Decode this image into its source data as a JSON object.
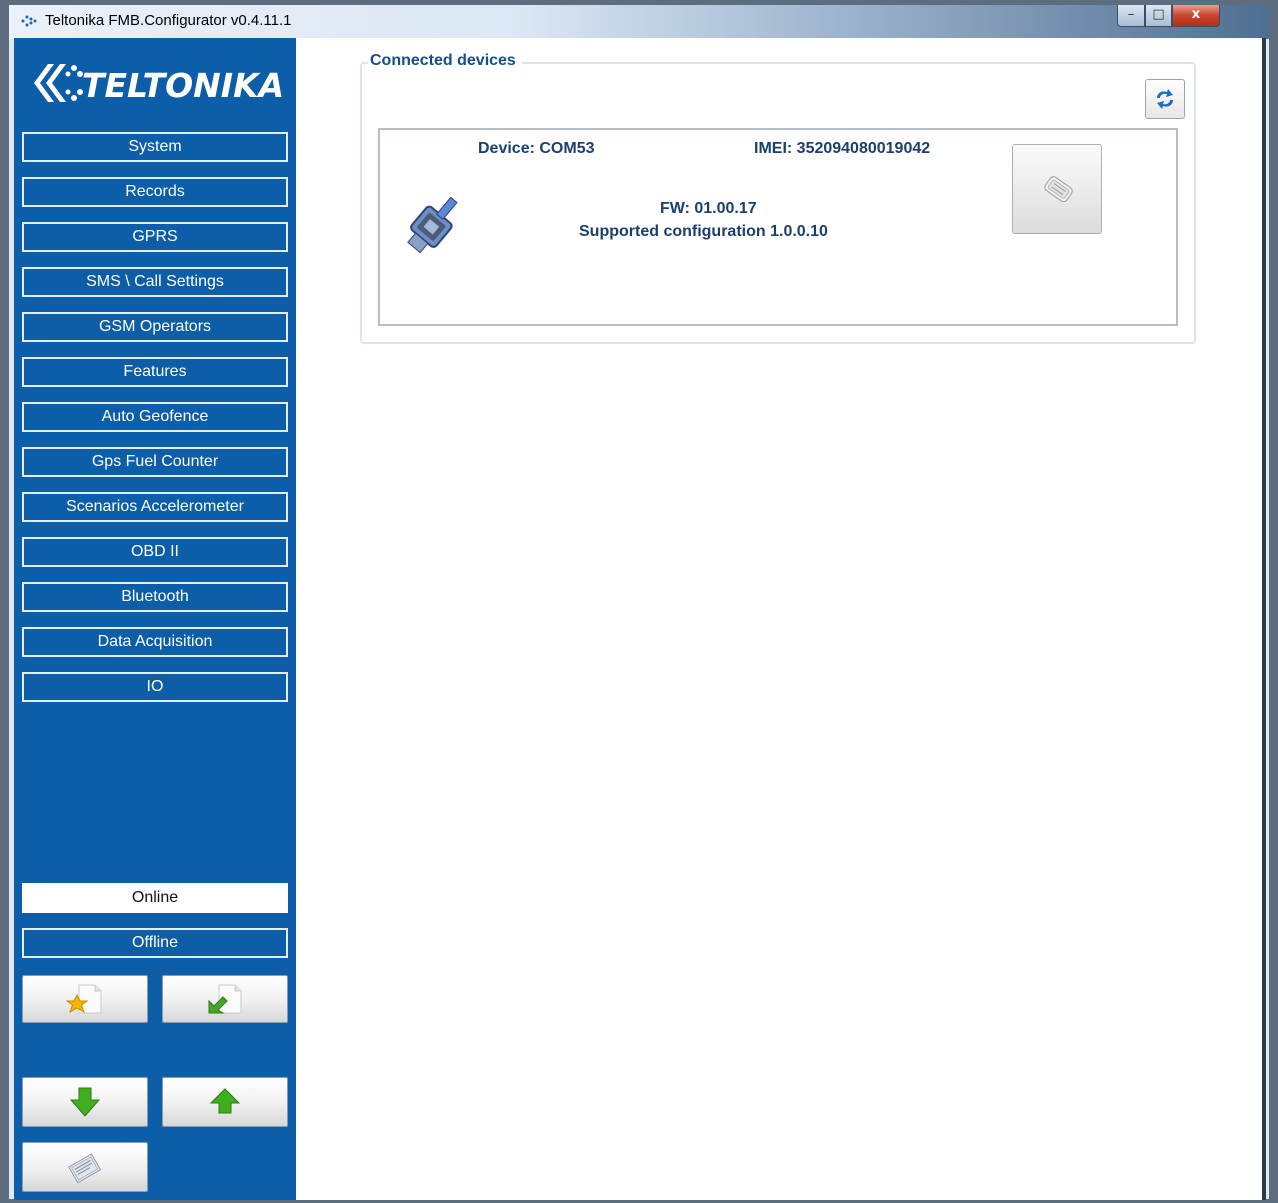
{
  "window": {
    "title": "Teltonika FMB.Configurator v0.4.11.1",
    "controls": {
      "minimize": "–",
      "maximize": "□",
      "close": "x"
    }
  },
  "brand": {
    "logo_text": "TELTONIKA",
    "color": "#0d5ea8"
  },
  "sidebar": {
    "items": [
      {
        "label": "System"
      },
      {
        "label": "Records"
      },
      {
        "label": "GPRS"
      },
      {
        "label": "SMS \\ Call Settings"
      },
      {
        "label": "GSM Operators"
      },
      {
        "label": "Features"
      },
      {
        "label": "Auto Geofence"
      },
      {
        "label": "Gps Fuel Counter"
      },
      {
        "label": "Scenarios Accelerometer"
      },
      {
        "label": "OBD II"
      },
      {
        "label": "Bluetooth"
      },
      {
        "label": "Data Acquisition"
      },
      {
        "label": "IO"
      }
    ],
    "mode_buttons": [
      {
        "label": "Online",
        "active": true
      },
      {
        "label": "Offline",
        "active": false
      }
    ],
    "action_icons": [
      "load-config-icon",
      "save-config-icon",
      "read-from-device-icon",
      "write-to-device-icon",
      "reset-config-icon"
    ]
  },
  "main": {
    "group_title": "Connected devices",
    "refresh_icon": "refresh-icon",
    "device": {
      "port": "Device: COM53",
      "imei": "IMEI: 352094080019042",
      "fw": "FW: 01.00.17",
      "config": "Supported configuration 1.0.0.10",
      "icon": "serial-port-icon",
      "connect_icon": "device-connect-icon"
    }
  }
}
